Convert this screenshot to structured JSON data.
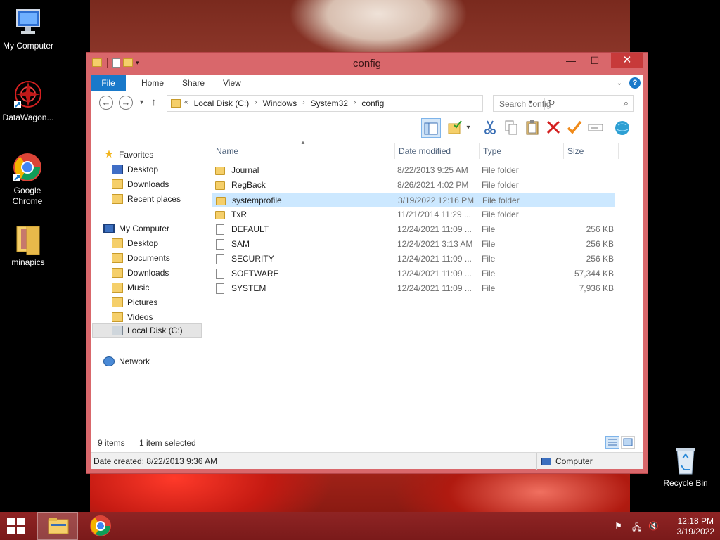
{
  "desktop": {
    "icons": [
      {
        "label": "My Computer"
      },
      {
        "label": "DataWagon..."
      },
      {
        "label": "Google Chrome"
      },
      {
        "label": "minapics"
      },
      {
        "label": "Recycle Bin"
      }
    ]
  },
  "window": {
    "title": "config",
    "ribbon_tabs": [
      "File",
      "Home",
      "Share",
      "View"
    ],
    "address": {
      "overflow": "«",
      "crumbs": [
        "Local Disk (C:)",
        "Windows",
        "System32",
        "config"
      ]
    },
    "search": {
      "placeholder": "Search config"
    },
    "nav": {
      "favorites_header": "Favorites",
      "favorites": [
        "Desktop",
        "Downloads",
        "Recent places"
      ],
      "computer_header": "My Computer",
      "computer": [
        "Desktop",
        "Documents",
        "Downloads",
        "Music",
        "Pictures",
        "Videos",
        "Local Disk (C:)"
      ],
      "network": "Network"
    },
    "columns": {
      "name": "Name",
      "date": "Date modified",
      "type": "Type",
      "size": "Size"
    },
    "files": [
      {
        "name": "Journal",
        "date": "8/22/2013 9:25 AM",
        "type": "File folder",
        "size": "",
        "kind": "folder"
      },
      {
        "name": "RegBack",
        "date": "8/26/2021 4:02 PM",
        "type": "File folder",
        "size": "",
        "kind": "folder"
      },
      {
        "name": "systemprofile",
        "date": "3/19/2022 12:16 PM",
        "type": "File folder",
        "size": "",
        "kind": "folder"
      },
      {
        "name": "TxR",
        "date": "11/21/2014 11:29 ...",
        "type": "File folder",
        "size": "",
        "kind": "folder"
      },
      {
        "name": "DEFAULT",
        "date": "12/24/2021 11:09 ...",
        "type": "File",
        "size": "256 KB",
        "kind": "file"
      },
      {
        "name": "SAM",
        "date": "12/24/2021 3:13 AM",
        "type": "File",
        "size": "256 KB",
        "kind": "file"
      },
      {
        "name": "SECURITY",
        "date": "12/24/2021 11:09 ...",
        "type": "File",
        "size": "256 KB",
        "kind": "file"
      },
      {
        "name": "SOFTWARE",
        "date": "12/24/2021 11:09 ...",
        "type": "File",
        "size": "57,344 KB",
        "kind": "file"
      },
      {
        "name": "SYSTEM",
        "date": "12/24/2021 11:09 ...",
        "type": "File",
        "size": "7,936 KB",
        "kind": "file"
      }
    ],
    "status": {
      "count": "9 items",
      "selected": "1 item selected"
    },
    "details": {
      "created": "Date created: 8/22/2013 9:36 AM",
      "zone": "Computer"
    }
  },
  "taskbar": {
    "time": "12:18 PM",
    "date": "3/19/2022"
  },
  "colors": {
    "accent": "#1979ca",
    "window_frame": "#d9676b",
    "selection": "#cce8ff",
    "taskbar": "#7a1a1a"
  }
}
